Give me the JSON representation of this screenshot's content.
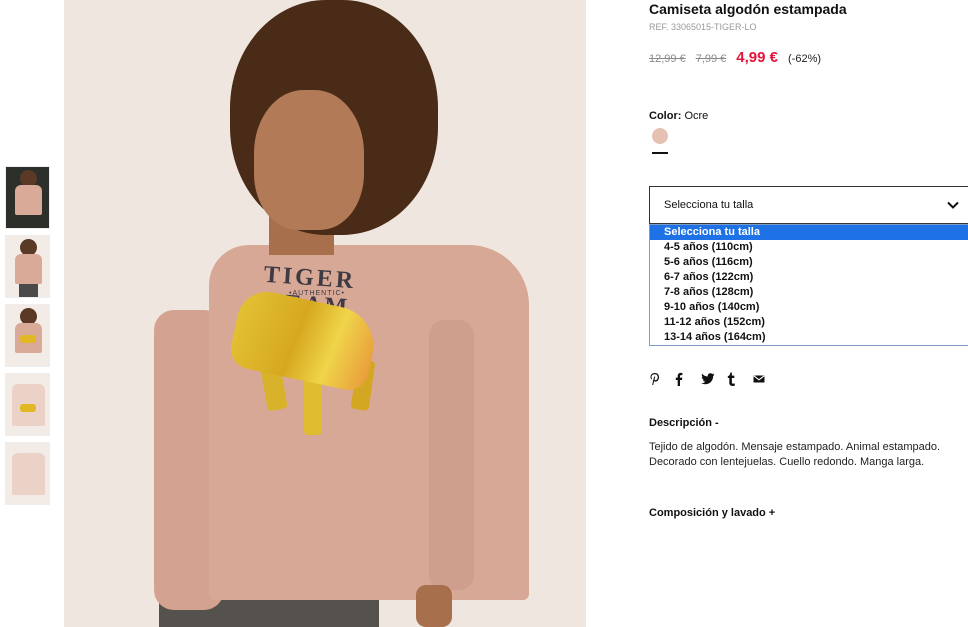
{
  "product": {
    "title": "Camiseta algodón estampada",
    "ref": "REF. 33065015-TIGER-LO",
    "prices": {
      "original": "12,99 €",
      "previous": "7,99 €",
      "current": "4,99 €",
      "discount": "(-62%)"
    },
    "color": {
      "label": "Color:",
      "value": "Ocre",
      "swatch_hex": "#e4c1b0"
    }
  },
  "size_selector": {
    "label": "Selecciona tu talla",
    "options": [
      "Selecciona tu talla",
      "4-5 años (110cm)",
      "5-6 años (116cm)",
      "6-7 años (122cm)",
      "7-8 años (128cm)",
      "9-10 años (140cm)",
      "11-12 años (152cm)",
      "13-14 años (164cm)"
    ],
    "highlighted_index": 0
  },
  "share_icons": [
    "pinterest-icon",
    "facebook-icon",
    "twitter-icon",
    "tumblr-icon",
    "email-icon"
  ],
  "description": {
    "title": "Descripción -",
    "text": "Tejido de algodón. Mensaje estampado. Animal estampado. Decorado con lentejuelas. Cuello redondo. Manga larga."
  },
  "composition": {
    "title": "Composición y lavado +"
  },
  "image_print": {
    "shirt_text": "TIGER TEAM",
    "shirt_subtext": "•AUTHENTIC•"
  },
  "colors": {
    "sale": "#e5143a",
    "selected_option_bg": "#1e72e6"
  }
}
